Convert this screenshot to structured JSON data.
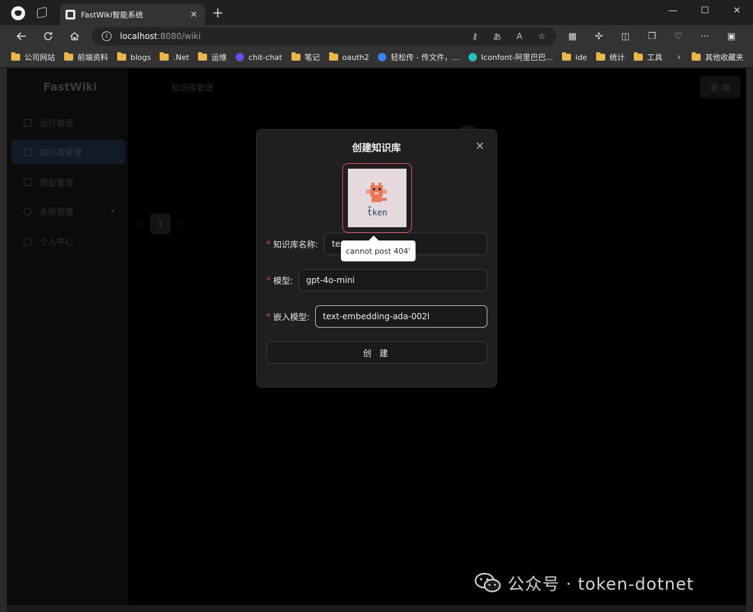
{
  "browser": {
    "tab_title": "FastWiki智能系统",
    "tab_close": "✕",
    "new_tab": "+",
    "url_host": "localhost",
    "url_rest": ":8080/wiki",
    "window_controls": [
      "—",
      "☐",
      "✕"
    ],
    "bookmarks": [
      {
        "label": "公司网站",
        "icon": "folder"
      },
      {
        "label": "前端资料",
        "icon": "folder"
      },
      {
        "label": "blogs",
        "icon": "folder"
      },
      {
        "label": ".Net",
        "icon": "folder"
      },
      {
        "label": "运维",
        "icon": "folder"
      },
      {
        "label": "chit-chat",
        "icon": "chat-logo",
        "color": "#6a4cf0"
      },
      {
        "label": "笔记",
        "icon": "folder"
      },
      {
        "label": "oauth2",
        "icon": "folder"
      },
      {
        "label": "轻松传 - 传文件，...",
        "icon": "cloud-logo",
        "color": "#3b82f6"
      },
      {
        "label": "Iconfont-阿里巴巴...",
        "icon": "iconfont-logo",
        "color": "#22c3c3"
      },
      {
        "label": "ide",
        "icon": "folder"
      },
      {
        "label": "统计",
        "icon": "folder"
      },
      {
        "label": "工具",
        "icon": "folder"
      }
    ],
    "bookmarks_more": "›",
    "other_bookmarks": "其他收藏夹"
  },
  "app": {
    "logo": "FastWiki",
    "menu": [
      {
        "label": "运行管理",
        "active": false
      },
      {
        "label": "知识库管理",
        "active": true
      },
      {
        "label": "模型管理",
        "active": false
      },
      {
        "label": "系统管理",
        "active": false,
        "has_arrow": true
      },
      {
        "label": "个人中心",
        "active": false
      }
    ],
    "header_title": "知识库管理",
    "new_button": "新 增",
    "pager": {
      "prev": "‹",
      "page": "1",
      "next": "›"
    }
  },
  "modal": {
    "title": "创建知识库",
    "close": "✕",
    "avatar_text": "t̊ken",
    "fields": {
      "name": {
        "label": "知识库名称:",
        "value": "tes"
      },
      "model": {
        "label": "模型:",
        "value": "gpt-4o-mini"
      },
      "embedding": {
        "label": "嵌入模型:",
        "value": "text-embedding-ada-002l"
      }
    },
    "required_mark": "*",
    "tooltip": "cannot post 404'",
    "create_button": "创 建"
  },
  "watermark": "公众号 · token-dotnet",
  "colors": {
    "accent_red": "#e04a6a",
    "required": "#e0455a",
    "folder": "#e8b64a"
  }
}
